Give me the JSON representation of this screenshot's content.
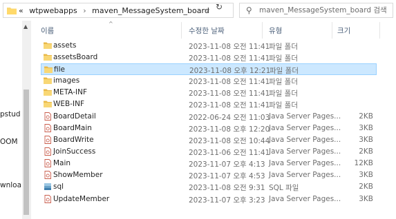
{
  "address_bar": {
    "overflow": "«",
    "crumbs": [
      "wtpwebapps",
      "maven_MessageSystem_board"
    ],
    "dropdown_icon": "chevron-down",
    "refresh_icon": "refresh"
  },
  "search": {
    "placeholder": "maven_MessageSystem_board 검색"
  },
  "nav": {
    "labels": [
      "pstud",
      "OOM",
      "wnloa"
    ]
  },
  "columns": {
    "name": "이름",
    "date": "수정한 날짜",
    "type": "유형",
    "size": "크기"
  },
  "colors": {
    "folder": "#f8d775",
    "selected_bg": "#cce8ff",
    "header_text": "#4c607a"
  },
  "files": [
    {
      "name": "assets",
      "date": "2023-11-08 오전 11:41",
      "type": "파일 폴더",
      "size": "",
      "icon": "folder",
      "selected": false
    },
    {
      "name": "assetsBoard",
      "date": "2023-11-08 오전 11:41",
      "type": "파일 폴더",
      "size": "",
      "icon": "folder",
      "selected": false
    },
    {
      "name": "file",
      "date": "2023-11-08 오후 12:21",
      "type": "파일 폴더",
      "size": "",
      "icon": "folder",
      "selected": true
    },
    {
      "name": "images",
      "date": "2023-11-08 오전 11:41",
      "type": "파일 폴더",
      "size": "",
      "icon": "folder",
      "selected": false
    },
    {
      "name": "META-INF",
      "date": "2023-11-08 오전 11:41",
      "type": "파일 폴더",
      "size": "",
      "icon": "folder",
      "selected": false
    },
    {
      "name": "WEB-INF",
      "date": "2023-11-08 오전 11:41",
      "type": "파일 폴더",
      "size": "",
      "icon": "folder",
      "selected": false
    },
    {
      "name": "BoardDetail",
      "date": "2022-06-24 오전 11:03",
      "type": "Java Server Pages...",
      "size": "2KB",
      "icon": "jsp",
      "selected": false
    },
    {
      "name": "BoardMain",
      "date": "2023-11-08 오후 12:20",
      "type": "Java Server Pages...",
      "size": "3KB",
      "icon": "jsp",
      "selected": false
    },
    {
      "name": "BoardWrite",
      "date": "2023-11-08 오전 10:44",
      "type": "Java Server Pages...",
      "size": "3KB",
      "icon": "jsp",
      "selected": false
    },
    {
      "name": "JoinSuccess",
      "date": "2023-11-06 오전 11:41",
      "type": "Java Server Pages...",
      "size": "2KB",
      "icon": "jsp",
      "selected": false
    },
    {
      "name": "Main",
      "date": "2023-11-07 오후 4:13",
      "type": "Java Server Pages...",
      "size": "12KB",
      "icon": "jsp",
      "selected": false
    },
    {
      "name": "ShowMember",
      "date": "2023-11-07 오후 4:53",
      "type": "Java Server Pages...",
      "size": "3KB",
      "icon": "jsp",
      "selected": false
    },
    {
      "name": "sql",
      "date": "2023-11-08 오전 9:31",
      "type": "SQL 파일",
      "size": "2KB",
      "icon": "sql",
      "selected": false
    },
    {
      "name": "UpdateMember",
      "date": "2023-11-07 오후 3:23",
      "type": "Java Server Pages...",
      "size": "3KB",
      "icon": "jsp",
      "selected": false
    }
  ]
}
